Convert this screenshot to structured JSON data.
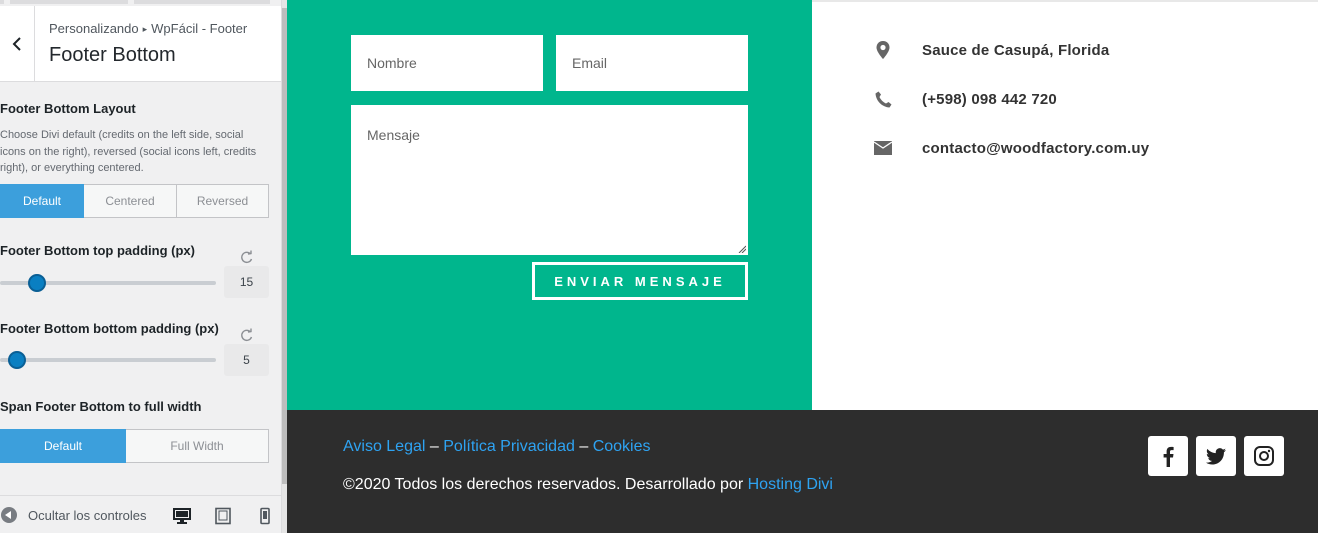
{
  "customizer": {
    "breadcrumb_root": "Personalizando",
    "breadcrumb_section": "WpFácil - Footer",
    "title": "Footer Bottom",
    "layout": {
      "title": "Footer Bottom Layout",
      "description": "Choose Divi default (credits on the left side, social icons on the right), reversed (social icons left, credits right), or everything centered.",
      "options": [
        "Default",
        "Centered",
        "Reversed"
      ],
      "selected": "Default"
    },
    "top_padding": {
      "title": "Footer Bottom top padding (px)",
      "value": "15"
    },
    "bottom_padding": {
      "title": "Footer Bottom bottom padding (px)",
      "value": "5"
    },
    "full_width": {
      "title": "Span Footer Bottom to full width",
      "options": [
        "Default",
        "Full Width"
      ],
      "selected": "Default"
    },
    "hide_controls_label": "Ocultar los controles"
  },
  "preview": {
    "form": {
      "name_placeholder": "Nombre",
      "email_placeholder": "Email",
      "message_placeholder": "Mensaje",
      "submit_label": "ENVIAR MENSAJE"
    },
    "contact": [
      {
        "icon": "map-marker-icon",
        "text": "Sauce de Casupá, Florida"
      },
      {
        "icon": "phone-icon",
        "text": "(+598) 098 442 720"
      },
      {
        "icon": "envelope-icon",
        "text": "contacto@woodfactory.com.uy"
      }
    ],
    "footer": {
      "link_legal": "Aviso Legal",
      "link_privacy": "Política Privacidad",
      "link_cookies": "Cookies",
      "separator": "–",
      "copyright_text": "©2020 Todos los derechos reservados. Desarrollado por",
      "credit_link": "Hosting Divi"
    },
    "social_icons": [
      "facebook-icon",
      "twitter-icon",
      "instagram-icon"
    ]
  },
  "colors": {
    "accent_blue": "#3c9fdc",
    "slider_blue": "#0a7fc2",
    "green": "#00b68d",
    "footer_dark": "#2d2d2d",
    "link_blue": "#2ea3f2"
  }
}
